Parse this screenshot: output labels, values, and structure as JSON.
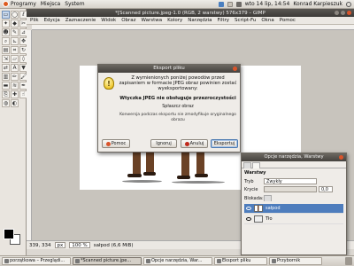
{
  "top_panel": {
    "menu": [
      "Programy",
      "Miejsca",
      "System"
    ],
    "datetime": "wto 14 lip, 14:54",
    "user": "Konrad Karpieszuk"
  },
  "image_window": {
    "title": "*[Scanned picture.jpeg-1.0 (RGB, 2 warstwy) 576x379 – GIMP",
    "menu": [
      "Plik",
      "Edycja",
      "Zaznaczenie",
      "Widok",
      "Obraz",
      "Warstwa",
      "Kolory",
      "Narzędzia",
      "Filtry",
      "Script-Fu",
      "Okna",
      "Pomoc"
    ],
    "status": {
      "coords": "339, 334",
      "unit": "px",
      "zoom": "100 %",
      "layer_info": "sałpod (6,6 MiB)"
    }
  },
  "export_dialog": {
    "title": "Eksport pliku",
    "message": "Z wymienionych poniżej powodów przed zapisaniem w formacie JPEG obraz powinien zostać wyeksportowany:",
    "warning": "Wtyczka JPEG nie obsługuje przezroczystości",
    "option": "Spłaszcz obraz",
    "note": "Konwersja podczas eksportu nie zmodyfikuje oryginalnego obrazu",
    "buttons": {
      "help": "Pomoc",
      "ignore": "Ignoruj",
      "cancel": "Anuluj",
      "export": "Eksportuj"
    }
  },
  "layers_panel": {
    "title": "Opcje narzędzia, Warstwy",
    "section": "Warstwy",
    "mode_label": "Tryb",
    "mode_value": "Zwykły",
    "opacity_label": "Krycie",
    "opacity_value": "0,0",
    "lock_label": "Blokada:",
    "layers": [
      {
        "name": "sałpod",
        "selected": true
      },
      {
        "name": "Tło",
        "selected": false
      }
    ]
  },
  "taskbar": {
    "items": [
      {
        "label": "porzątkowa – Przeglądi...",
        "active": false
      },
      {
        "label": "*Scanned picture.jpe...",
        "active": true
      },
      {
        "label": "Opcje narzędzia, War...",
        "active": false
      },
      {
        "label": "Eksport pliku",
        "active": false
      },
      {
        "label": "Przybornik",
        "active": false
      }
    ]
  },
  "colors": {
    "selection": "#4e7dbd",
    "titlebar": "#45423e",
    "desktop": "#b46a3c"
  }
}
